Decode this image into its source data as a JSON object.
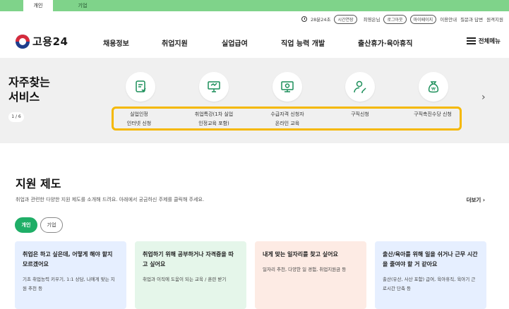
{
  "top_tabs": [
    "개인",
    "기업"
  ],
  "util": {
    "timer": "28분24초",
    "extend": "시간연장",
    "user": "최영은님",
    "logout": "로그아웃",
    "mypage": "마이페이지",
    "guide": "이용안내",
    "qna": "질문과 답변",
    "remote": "원격지원"
  },
  "logo": {
    "text": "고용24"
  },
  "nav": [
    "채용정보",
    "취업지원",
    "실업급여",
    "직업 능력 개발",
    "출산휴가·육아휴직"
  ],
  "menu_all": "전체메뉴",
  "frequent": {
    "title_line1": "자주찾는",
    "title_line2": "서비스",
    "page": "1 / 6",
    "items": [
      {
        "line1": "실업인정",
        "line2": "인터넷 신청",
        "icon": "certificate-form-icon"
      },
      {
        "line1": "취업특강(1차 실업",
        "line2": "인정교육 포함)",
        "icon": "lecture-board-icon"
      },
      {
        "line1": "수급자격 신청자",
        "line2": "온라인 교육",
        "icon": "monitor-education-icon"
      },
      {
        "line1": "구직신청",
        "line2": "",
        "icon": "job-seeker-icon"
      },
      {
        "line1": "구직촉진수당 신청",
        "line2": "",
        "icon": "allowance-bag-icon"
      }
    ],
    "highlight_color": "#f5b800"
  },
  "support": {
    "title": "지원 제도",
    "desc": "취업과 관련한 다양한 지원 제도를 소개해 드려요. 아래에서 궁금하신 주제를 클릭해 주세요.",
    "more": "더보기",
    "chips": [
      "개인",
      "기업"
    ],
    "cards": [
      {
        "title": "취업은 하고 싶은데, 어떻게 해야 할지 모르겠어요",
        "desc": "기초 취업능력 키우기, 1:1 상담, 나에게 맞는 지원 추천 등",
        "bg": "#e6efff"
      },
      {
        "title": "취업하기 위해 공부하거나 자격증을 따고 싶어요",
        "desc": "취업과 이직에 도움이 되는 교육 / 훈련 받기",
        "bg": "#e5f6ea"
      },
      {
        "title": "내게 맞는 일자리를 찾고 싶어요",
        "desc": "일자리 추천, 다양한 일 경험, 취업지원금 등",
        "bg": "#fdebe4"
      },
      {
        "title": "출산/육아를 위해 일을 쉬거나 근무 시간을 줄여야 할 거 같아요",
        "desc": "출산(유산, 사산 포함) 급여, 육아휴직, 육아기 근로시간 단축 등",
        "bg": "#e6efff"
      }
    ]
  },
  "colors": {
    "topbar": "#7fd38a",
    "chip_active": "#1fae67",
    "band": "#f0f0f0"
  }
}
